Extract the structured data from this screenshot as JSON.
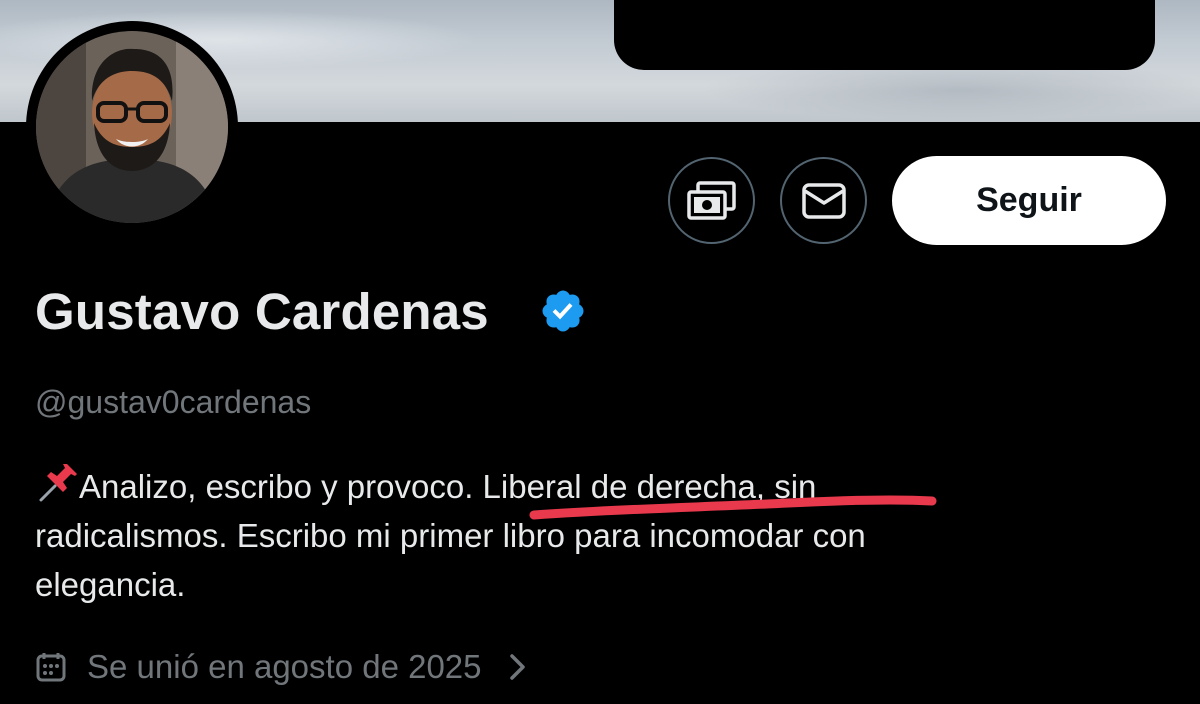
{
  "profile": {
    "display_name": "Gustavo Cardenas",
    "handle": "@gustav0cardenas",
    "verified": true,
    "bio_lines": [
      "Analizo, escribo y provoco. Liberal de derecha, sin",
      "radicalismos. Escribo mi primer libro para incomodar con",
      "elegancia."
    ],
    "joined": "Se unió en agosto de 2025"
  },
  "actions": {
    "follow_label": "Seguir",
    "tip_icon": "money-icon",
    "message_icon": "mail-icon"
  },
  "colors": {
    "background": "#000000",
    "primary_text": "#e7e9ea",
    "secondary_text": "#71767b",
    "verified_blue": "#1d9bf0",
    "underline_mark": "#e8394d"
  }
}
